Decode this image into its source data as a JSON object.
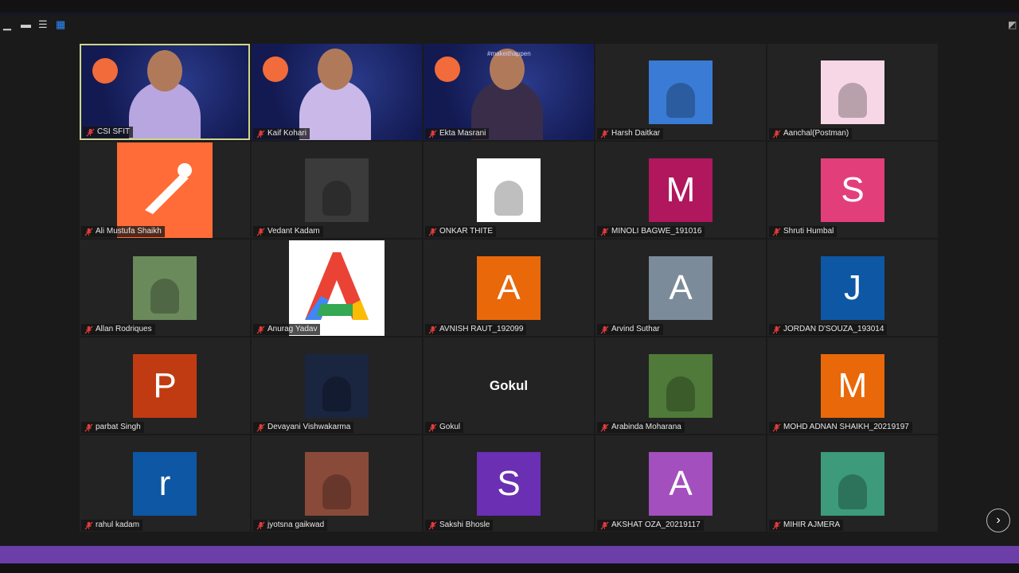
{
  "view_controls": [
    "minimize-icon",
    "speaker-view-icon",
    "grid-view-icon"
  ],
  "participants": [
    {
      "name": "CSI SFIT",
      "type": "video",
      "active": true
    },
    {
      "name": "Kaif Kohari",
      "type": "video"
    },
    {
      "name": "Ekta Masrani",
      "type": "video"
    },
    {
      "name": "Harsh Daitkar",
      "type": "photo",
      "color": "#3a7bd5"
    },
    {
      "name": "Aanchal(Postman)",
      "type": "photo",
      "color": "#f7d7e6"
    },
    {
      "name": "Ali Mustufa Shaikh",
      "type": "logo",
      "color": "#ff6c37"
    },
    {
      "name": "Vedant Kadam",
      "type": "photo",
      "color": "#3b3b3b"
    },
    {
      "name": "ONKAR THITE",
      "type": "photo",
      "color": "#ffffff"
    },
    {
      "name": "MINOLI BAGWE_191016",
      "type": "letter",
      "letter": "M",
      "color": "#b0175d"
    },
    {
      "name": "Shruti Humbal",
      "type": "letter",
      "letter": "S",
      "color": "#e23f7a"
    },
    {
      "name": "Allan Rodriques",
      "type": "photo",
      "color": "#6b8a5c"
    },
    {
      "name": "Anurag Yadav",
      "type": "logo",
      "color": "#ffffff"
    },
    {
      "name": "AVNISH RAUT_192099",
      "type": "letter",
      "letter": "A",
      "color": "#e8680a"
    },
    {
      "name": "Arvind Suthar",
      "type": "letter",
      "letter": "A",
      "color": "#7b8b99"
    },
    {
      "name": "JORDAN D'SOUZA_193014",
      "type": "letter",
      "letter": "J",
      "color": "#0d57a5"
    },
    {
      "name": "parbat Singh",
      "type": "letter",
      "letter": "P",
      "color": "#c13b12"
    },
    {
      "name": "Devayani Vishwakarma",
      "type": "photo",
      "color": "#1a2540"
    },
    {
      "name": "Gokul",
      "type": "name",
      "display": "Gokul"
    },
    {
      "name": "Arabinda Moharana",
      "type": "photo",
      "color": "#4f7a3a"
    },
    {
      "name": "MOHD ADNAN SHAIKH_20219197",
      "type": "letter",
      "letter": "M",
      "color": "#e8680a"
    },
    {
      "name": "rahul kadam",
      "type": "letter",
      "letter": "r",
      "color": "#0d57a5"
    },
    {
      "name": "jyotsna gaikwad",
      "type": "photo",
      "color": "#8a4a3a"
    },
    {
      "name": "Sakshi Bhosle",
      "type": "letter",
      "letter": "S",
      "color": "#6a2fb3"
    },
    {
      "name": "AKSHAT OZA_20219117",
      "type": "letter",
      "letter": "A",
      "color": "#a34fbd"
    },
    {
      "name": "MIHIR AJMERA",
      "type": "photo",
      "color": "#3d9a7a"
    }
  ],
  "video_hashtag": "#makeithappen",
  "next_page_label": "›",
  "colors": {
    "accent_bar": "#6b3ea8",
    "active_border": "#cfd68a",
    "mic_muted": "#e23b3b"
  }
}
